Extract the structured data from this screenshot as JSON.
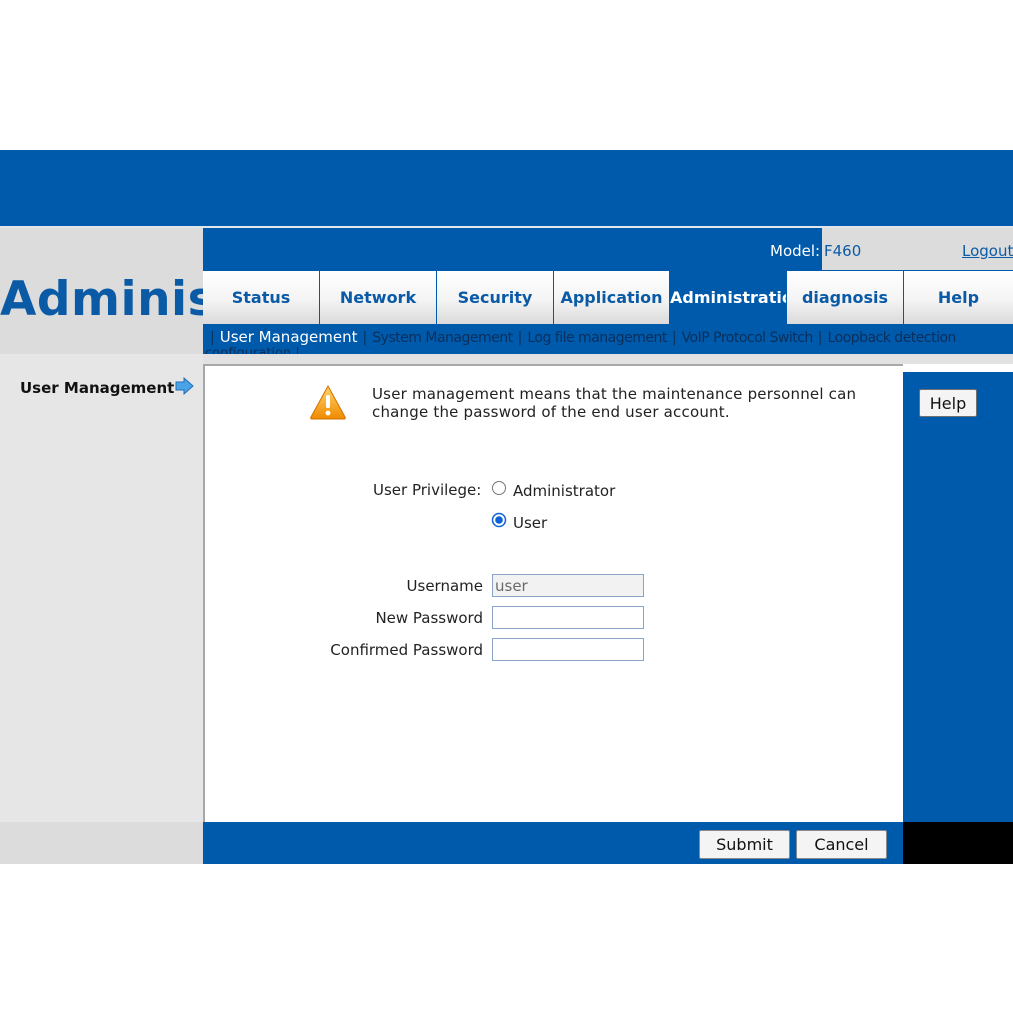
{
  "header": {
    "big_title": "Adminis",
    "model_label": "Model:",
    "model_value": "F460",
    "logout": "Logout"
  },
  "tabs": [
    {
      "label": "Status",
      "active": false
    },
    {
      "label": "Network",
      "active": false
    },
    {
      "label": "Security",
      "active": false
    },
    {
      "label": "Application",
      "active": false
    },
    {
      "label": "Administration",
      "active": true
    },
    {
      "label": "diagnosis",
      "active": false
    },
    {
      "label": "Help",
      "active": false
    }
  ],
  "subnav": {
    "active": "User Management",
    "items": [
      "System Management",
      "Log file management",
      "VoIP Protocol Switch",
      "Loopback detection"
    ],
    "second_line": "configuration"
  },
  "sidebar": {
    "title": "User Management",
    "arrow_icon": "right-arrow-icon"
  },
  "main": {
    "warning_icon": "warning-icon",
    "info_text": "User management means that the maintenance personnel can change the password of the end user account.",
    "help_button": "Help",
    "privilege_label": "User Privilege:",
    "options": {
      "administrator": "Administrator",
      "user": "User"
    },
    "selected_privilege": "User",
    "username_label": "Username",
    "username_value": "user",
    "new_password_label": "New Password",
    "new_password_value": "",
    "confirmed_password_label": "Confirmed Password",
    "confirmed_password_value": ""
  },
  "footer": {
    "submit": "Submit",
    "cancel": "Cancel"
  },
  "colors": {
    "brand_blue": "#005aab",
    "panel_grey": "#e6e6e6",
    "link_blue": "#0a5aa6"
  }
}
